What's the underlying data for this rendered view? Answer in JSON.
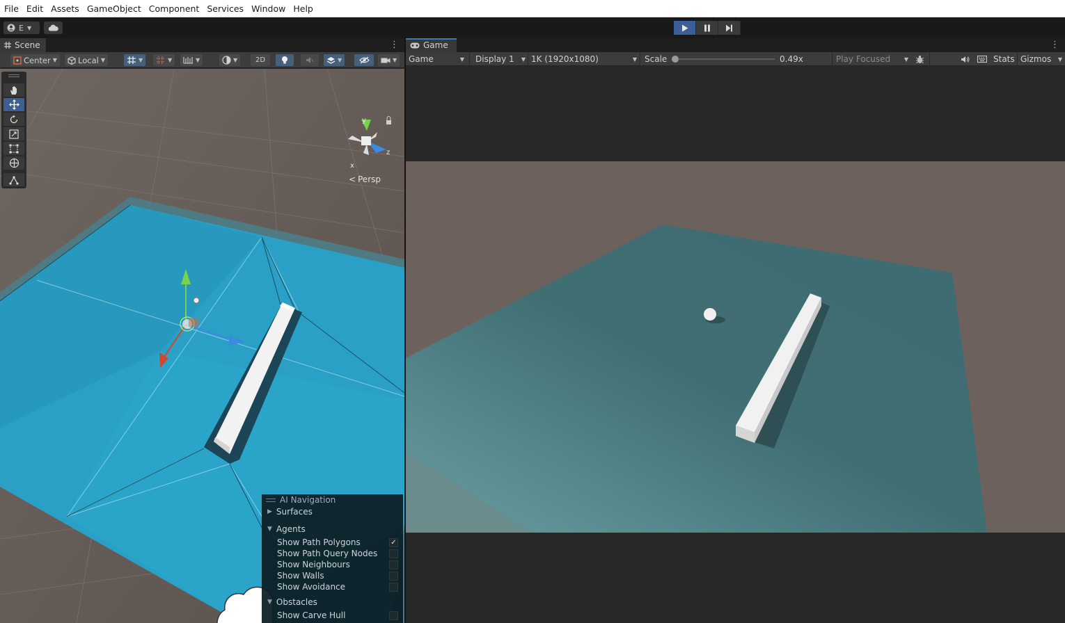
{
  "menu": [
    "File",
    "Edit",
    "Assets",
    "GameObject",
    "Component",
    "Services",
    "Window",
    "Help"
  ],
  "toolbar": {
    "account_label": "E",
    "play_active": true
  },
  "scene": {
    "tab_label": "Scene",
    "pivot_label": "Center",
    "space_label": "Local",
    "mode_2d_label": "2D",
    "gizmo_persp_label": "Persp",
    "axis_x": "x",
    "axis_y": "y",
    "axis_z": "z"
  },
  "ai_navigation": {
    "title": "AI Navigation",
    "surfaces_label": "Surfaces",
    "agents_label": "Agents",
    "agent_options": [
      {
        "label": "Show Path Polygons",
        "checked": true
      },
      {
        "label": "Show Path Query Nodes",
        "checked": false
      },
      {
        "label": "Show Neighbours",
        "checked": false
      },
      {
        "label": "Show Walls",
        "checked": false
      },
      {
        "label": "Show Avoidance",
        "checked": false
      }
    ],
    "obstacles_label": "Obstacles",
    "obstacle_options": [
      {
        "label": "Show Carve Hull",
        "checked": false
      }
    ]
  },
  "game": {
    "tab_label": "Game",
    "view_select": "Game",
    "display_select": "Display 1",
    "resolution_select": "1K (1920x1080)",
    "scale_label": "Scale",
    "scale_value": "0.49x",
    "play_mode_select": "Play Focused",
    "stats_label": "Stats",
    "gizmos_label": "Gizmos"
  },
  "colors": {
    "accent_blue": "#3a79bb",
    "play_active_bg": "#3c5f9a",
    "navmesh_blue": "#2ea0c4",
    "ground_brown": "#6d625d",
    "game_floor": "#45757a"
  }
}
